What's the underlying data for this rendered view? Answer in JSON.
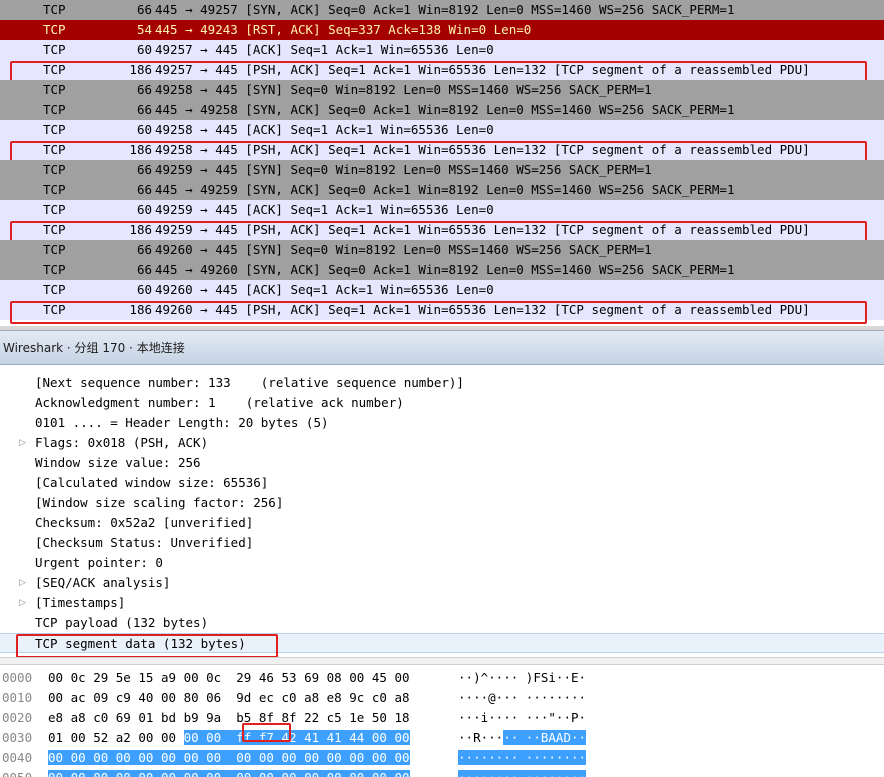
{
  "packets": [
    {
      "proto": "TCP",
      "len": "66",
      "info": "445 → 49257 [SYN, ACK] Seq=0 Ack=1 Win=8192 Len=0 MSS=1460 WS=256 SACK_PERM=1",
      "style": "gray",
      "hl": false
    },
    {
      "proto": "TCP",
      "len": "54",
      "info": "445 → 49243 [RST, ACK] Seq=337 Ack=138 Win=0 Len=0",
      "style": "red",
      "hl": false
    },
    {
      "proto": "TCP",
      "len": "60",
      "info": "49257 → 445 [ACK] Seq=1 Ack=1 Win=65536 Len=0",
      "style": "lav",
      "hl": false
    },
    {
      "proto": "TCP",
      "len": "186",
      "info": "49257 → 445 [PSH, ACK] Seq=1 Ack=1 Win=65536 Len=132 [TCP segment of a reassembled PDU]",
      "style": "lav",
      "hl": true
    },
    {
      "proto": "TCP",
      "len": "66",
      "info": "49258 → 445 [SYN] Seq=0 Win=8192 Len=0 MSS=1460 WS=256 SACK_PERM=1",
      "style": "gray",
      "hl": false
    },
    {
      "proto": "TCP",
      "len": "66",
      "info": "445 → 49258 [SYN, ACK] Seq=0 Ack=1 Win=8192 Len=0 MSS=1460 WS=256 SACK_PERM=1",
      "style": "gray",
      "hl": false
    },
    {
      "proto": "TCP",
      "len": "60",
      "info": "49258 → 445 [ACK] Seq=1 Ack=1 Win=65536 Len=0",
      "style": "lav",
      "hl": false
    },
    {
      "proto": "TCP",
      "len": "186",
      "info": "49258 → 445 [PSH, ACK] Seq=1 Ack=1 Win=65536 Len=132 [TCP segment of a reassembled PDU]",
      "style": "lav",
      "hl": true
    },
    {
      "proto": "TCP",
      "len": "66",
      "info": "49259 → 445 [SYN] Seq=0 Win=8192 Len=0 MSS=1460 WS=256 SACK_PERM=1",
      "style": "gray",
      "hl": false
    },
    {
      "proto": "TCP",
      "len": "66",
      "info": "445 → 49259 [SYN, ACK] Seq=0 Ack=1 Win=8192 Len=0 MSS=1460 WS=256 SACK_PERM=1",
      "style": "gray",
      "hl": false
    },
    {
      "proto": "TCP",
      "len": "60",
      "info": "49259 → 445 [ACK] Seq=1 Ack=1 Win=65536 Len=0",
      "style": "lav",
      "hl": false
    },
    {
      "proto": "TCP",
      "len": "186",
      "info": "49259 → 445 [PSH, ACK] Seq=1 Ack=1 Win=65536 Len=132 [TCP segment of a reassembled PDU]",
      "style": "lav",
      "hl": true
    },
    {
      "proto": "TCP",
      "len": "66",
      "info": "49260 → 445 [SYN] Seq=0 Win=8192 Len=0 MSS=1460 WS=256 SACK_PERM=1",
      "style": "gray",
      "hl": false
    },
    {
      "proto": "TCP",
      "len": "66",
      "info": "445 → 49260 [SYN, ACK] Seq=0 Ack=1 Win=8192 Len=0 MSS=1460 WS=256 SACK_PERM=1",
      "style": "gray",
      "hl": false
    },
    {
      "proto": "TCP",
      "len": "60",
      "info": "49260 → 445 [ACK] Seq=1 Ack=1 Win=65536 Len=0",
      "style": "lav",
      "hl": false
    },
    {
      "proto": "TCP",
      "len": "186",
      "info": "49260 → 445 [PSH, ACK] Seq=1 Ack=1 Win=65536 Len=132 [TCP segment of a reassembled PDU]",
      "style": "lav",
      "hl": true
    }
  ],
  "window_title": "Wireshark · 分组 170 · 本地连接",
  "details": [
    {
      "text": "[Next sequence number: 133    (relative sequence number)]",
      "expandable": false,
      "selected": false
    },
    {
      "text": "Acknowledgment number: 1    (relative ack number)",
      "expandable": false,
      "selected": false
    },
    {
      "text": "0101 .... = Header Length: 20 bytes (5)",
      "expandable": false,
      "selected": false
    },
    {
      "text": "Flags: 0x018 (PSH, ACK)",
      "expandable": true,
      "selected": false
    },
    {
      "text": "Window size value: 256",
      "expandable": false,
      "selected": false
    },
    {
      "text": "[Calculated window size: 65536]",
      "expandable": false,
      "selected": false
    },
    {
      "text": "[Window size scaling factor: 256]",
      "expandable": false,
      "selected": false
    },
    {
      "text": "Checksum: 0x52a2 [unverified]",
      "expandable": false,
      "selected": false
    },
    {
      "text": "[Checksum Status: Unverified]",
      "expandable": false,
      "selected": false
    },
    {
      "text": "Urgent pointer: 0",
      "expandable": false,
      "selected": false
    },
    {
      "text": "[SEQ/ACK analysis]",
      "expandable": true,
      "selected": false
    },
    {
      "text": "[Timestamps]",
      "expandable": true,
      "selected": false
    },
    {
      "text": "TCP payload (132 bytes)",
      "expandable": false,
      "selected": false
    },
    {
      "text": "TCP segment data (132 bytes)",
      "expandable": false,
      "selected": true
    }
  ],
  "hex_rows": [
    {
      "offset": "0000",
      "bytes": [
        "00",
        "0c",
        "29",
        "5e",
        "15",
        "a9",
        "00",
        "0c",
        "29",
        "46",
        "53",
        "69",
        "08",
        "00",
        "45",
        "00"
      ],
      "ascii": [
        "·",
        "·",
        ")",
        "^",
        "·",
        "·",
        "·",
        "·",
        ")",
        "F",
        "S",
        "i",
        "·",
        "·",
        "E",
        "·"
      ],
      "sel_from": 16
    },
    {
      "offset": "0010",
      "bytes": [
        "00",
        "ac",
        "09",
        "c9",
        "40",
        "00",
        "80",
        "06",
        "9d",
        "ec",
        "c0",
        "a8",
        "e8",
        "9c",
        "c0",
        "a8"
      ],
      "ascii": [
        "·",
        "·",
        "·",
        "·",
        "@",
        "·",
        "·",
        "·",
        "·",
        "·",
        "·",
        "·",
        "·",
        "·",
        "·",
        "·"
      ],
      "sel_from": 16
    },
    {
      "offset": "0020",
      "bytes": [
        "e8",
        "a8",
        "c0",
        "69",
        "01",
        "bd",
        "b9",
        "9a",
        "b5",
        "8f",
        "8f",
        "22",
        "c5",
        "1e",
        "50",
        "18"
      ],
      "ascii": [
        "·",
        "·",
        "·",
        "i",
        "·",
        "·",
        "·",
        "·",
        "·",
        "·",
        "·",
        "\"",
        "·",
        "·",
        "P",
        "·"
      ],
      "sel_from": 16
    },
    {
      "offset": "0030",
      "bytes": [
        "01",
        "00",
        "52",
        "a2",
        "00",
        "00",
        "00",
        "00",
        "ff",
        "f7",
        "42",
        "41",
        "41",
        "44",
        "00",
        "00"
      ],
      "ascii": [
        "·",
        "·",
        "R",
        "·",
        "·",
        "·",
        "·",
        "·",
        "·",
        "·",
        "B",
        "A",
        "A",
        "D",
        "·",
        "·"
      ],
      "sel_from": 6
    },
    {
      "offset": "0040",
      "bytes": [
        "00",
        "00",
        "00",
        "00",
        "00",
        "00",
        "00",
        "00",
        "00",
        "00",
        "00",
        "00",
        "00",
        "00",
        "00",
        "00"
      ],
      "ascii": [
        "·",
        "·",
        "·",
        "·",
        "·",
        "·",
        "·",
        "·",
        "·",
        "·",
        "·",
        "·",
        "·",
        "·",
        "·",
        "·"
      ],
      "sel_from": 0
    },
    {
      "offset": "0050",
      "bytes": [
        "00",
        "00",
        "00",
        "00",
        "00",
        "00",
        "00",
        "00",
        "00",
        "00",
        "00",
        "00",
        "00",
        "00",
        "00",
        "00"
      ],
      "ascii": [
        "·",
        "·",
        "·",
        "·",
        "·",
        "·",
        "·",
        "·",
        "·",
        "·",
        "·",
        "·",
        "·",
        "·",
        "·",
        "·"
      ],
      "sel_from": 0
    }
  ],
  "colors": {
    "row_gray": "#a0a0a0",
    "row_lavender": "#e7e6ff",
    "row_red": "#a40000",
    "highlight_box": "#e02020",
    "hex_selection": "#3da0ff"
  }
}
